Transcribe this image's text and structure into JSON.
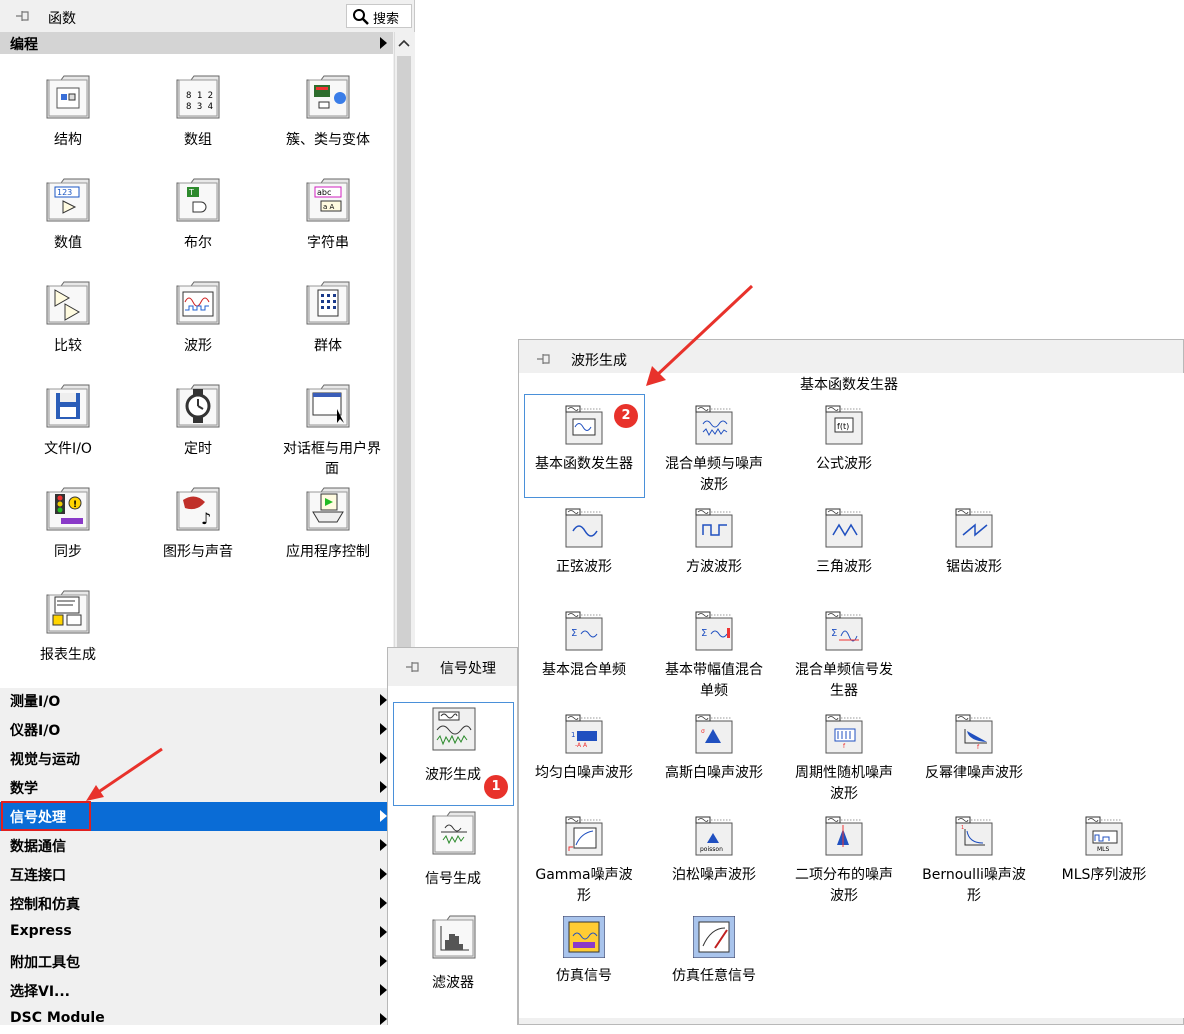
{
  "palette": {
    "title": "函数",
    "search_label": "搜索",
    "category": "编程",
    "items": [
      {
        "label": "结构",
        "icon": "structures-icon"
      },
      {
        "label": "数组",
        "icon": "array-icon"
      },
      {
        "label": "簇、类与变体",
        "icon": "cluster-class-variant-icon"
      },
      {
        "label": "数值",
        "icon": "numeric-icon"
      },
      {
        "label": "布尔",
        "icon": "boolean-icon"
      },
      {
        "label": "字符串",
        "icon": "string-icon"
      },
      {
        "label": "比较",
        "icon": "comparison-icon"
      },
      {
        "label": "波形",
        "icon": "waveform-icon"
      },
      {
        "label": "群体",
        "icon": "collection-icon"
      },
      {
        "label": "文件I/O",
        "icon": "file-io-icon"
      },
      {
        "label": "定时",
        "icon": "timing-icon"
      },
      {
        "label": "对话框与用户界面",
        "icon": "dialog-ui-icon"
      },
      {
        "label": "同步",
        "icon": "synchronization-icon"
      },
      {
        "label": "图形与声音",
        "icon": "graphics-sound-icon"
      },
      {
        "label": "应用程序控制",
        "icon": "app-control-icon"
      },
      {
        "label": "报表生成",
        "icon": "report-generation-icon"
      }
    ],
    "categories": [
      {
        "label": "测量I/O"
      },
      {
        "label": "仪器I/O"
      },
      {
        "label": "视觉与运动"
      },
      {
        "label": "数学"
      },
      {
        "label": "信号处理",
        "selected": true
      },
      {
        "label": "数据通信"
      },
      {
        "label": "互连接口"
      },
      {
        "label": "控制和仿真"
      },
      {
        "label": "Express"
      },
      {
        "label": "附加工具包"
      },
      {
        "label": "选择VI..."
      },
      {
        "label": "DSC Module"
      }
    ]
  },
  "signal_palette": {
    "title": "信号处理",
    "items": [
      {
        "label": "波形生成"
      },
      {
        "label": "信号生成"
      },
      {
        "label": "滤波器"
      }
    ],
    "badge": "1"
  },
  "wave_palette": {
    "title": "波形生成",
    "subtitle": "基本函数发生器",
    "badge": "2",
    "items": [
      {
        "label": "基本函数发生器"
      },
      {
        "label": "混合单频与噪声波形"
      },
      {
        "label": "公式波形"
      },
      {
        "label": "正弦波形"
      },
      {
        "label": "方波波形"
      },
      {
        "label": "三角波形"
      },
      {
        "label": "锯齿波形"
      },
      {
        "label": "基本混合单频"
      },
      {
        "label": "基本带幅值混合单频"
      },
      {
        "label": "混合单频信号发生器"
      },
      {
        "label": "均匀白噪声波形"
      },
      {
        "label": "高斯白噪声波形"
      },
      {
        "label": "周期性随机噪声波形"
      },
      {
        "label": "反幂律噪声波形"
      },
      {
        "label": "Gamma噪声波形"
      },
      {
        "label": "泊松噪声波形"
      },
      {
        "label": "二项分布的噪声波形"
      },
      {
        "label": "Bernoulli噪声波形"
      },
      {
        "label": "MLS序列波形"
      },
      {
        "label": "仿真信号"
      },
      {
        "label": "仿真任意信号"
      }
    ],
    "icon_text": {
      "formula": "f(t)",
      "poisson": "poisson",
      "mls": "MLS"
    }
  },
  "colors": {
    "selected_bg": "#0a6cd6",
    "annotation_red": "#e8322b",
    "highlight_blue": "#4a90d9"
  }
}
